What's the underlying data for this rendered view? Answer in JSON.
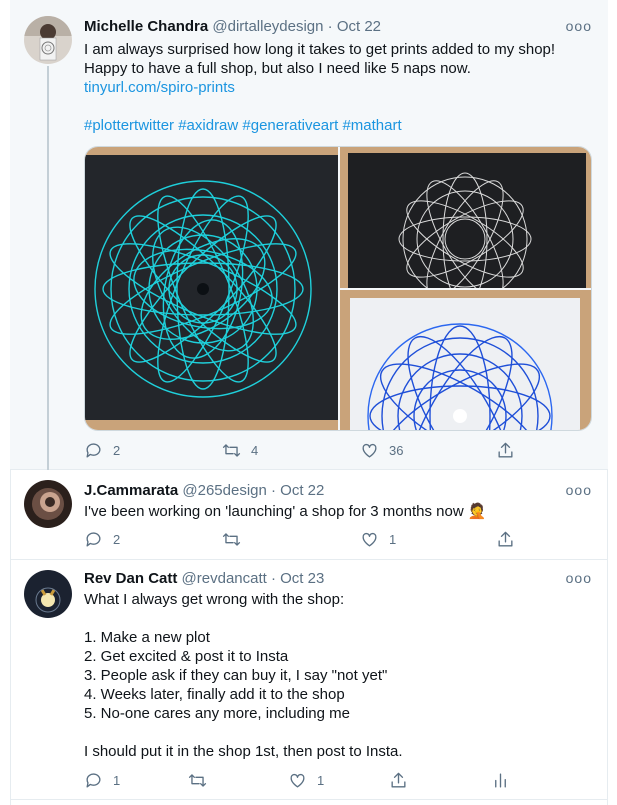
{
  "tweets": [
    {
      "author_name": "Michelle Chandra",
      "handle_date": "@dirtalleydesign · Oct 22",
      "text_lines": [
        "I am always surprised how long it takes to get prints added to my shop!",
        "Happy to have a full shop, but also I need like 5 naps now."
      ],
      "link": "tinyurl.com/spiro-prints",
      "hashtags": "#plottertwitter #axidraw #generativeart #mathart",
      "more_label": "ooo",
      "replies": "2",
      "retweets": "4",
      "likes": "36"
    },
    {
      "author_name": "J.Cammarata",
      "handle_date": "@265design · Oct 22",
      "text": "I've been working on 'launching' a shop for 3 months now 🤦",
      "more_label": "ooo",
      "replies": "2",
      "retweets": "",
      "likes": "1"
    },
    {
      "author_name": "Rev Dan Catt",
      "handle_date": "@revdancatt · Oct 23",
      "text_lines": [
        "What I always get wrong with the shop:",
        "",
        "1. Make a new plot",
        "2. Get excited & post it to Insta",
        "3. People ask if they can buy it, I say \"not yet\"",
        "4. Weeks later, finally add it to the shop",
        "5. No-one cares any more, including me",
        "",
        "I should put it in the shop 1st, then post to Insta."
      ],
      "more_label": "ooo",
      "replies": "1",
      "retweets": "",
      "likes": "1"
    }
  ],
  "icons": {
    "reply": "reply-icon",
    "retweet": "retweet-icon",
    "like": "heart-icon",
    "share": "share-icon",
    "analytics": "analytics-icon"
  },
  "colors": {
    "accent": "#1b95e0",
    "muted": "#5b7083",
    "highlight_bg": "#f5f8fa",
    "cyan_print": "#1fe3ef",
    "blue_print": "#1f4fd8"
  }
}
